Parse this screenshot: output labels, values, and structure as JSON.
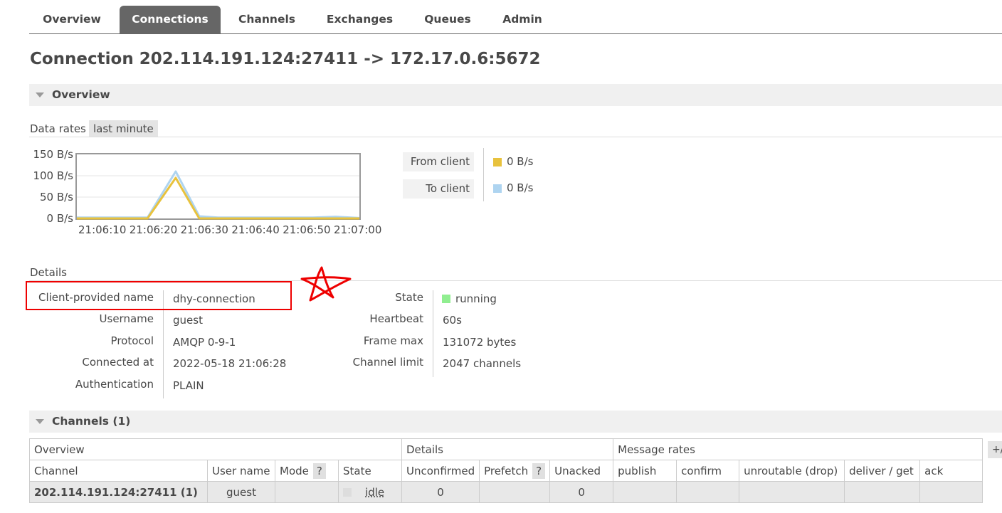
{
  "nav": {
    "tabs": [
      {
        "label": "Overview",
        "active": false
      },
      {
        "label": "Connections",
        "active": true
      },
      {
        "label": "Channels",
        "active": false
      },
      {
        "label": "Exchanges",
        "active": false
      },
      {
        "label": "Queues",
        "active": false
      },
      {
        "label": "Admin",
        "active": false
      }
    ]
  },
  "page_title": "Connection 202.114.191.124:27411 -> 172.17.0.6:5672",
  "overview_section": {
    "label": "Overview",
    "data_rates_label": "Data rates",
    "range_pill": "last minute"
  },
  "chart_data": {
    "type": "line",
    "y_ticks": [
      "150 B/s",
      "100 B/s",
      "50 B/s",
      "0 B/s"
    ],
    "x_ticks": [
      "21:06:10",
      "21:06:20",
      "21:06:30",
      "21:06:40",
      "21:06:50",
      "21:07:00"
    ],
    "ylim": [
      0,
      150
    ],
    "series": [
      {
        "name": "From client",
        "color": "#e8c23d",
        "points": [
          [
            0,
            0
          ],
          [
            15,
            0
          ],
          [
            21,
            95
          ],
          [
            26,
            0
          ],
          [
            60,
            0
          ]
        ]
      },
      {
        "name": "To client",
        "color": "#aed4f0",
        "points": [
          [
            0,
            2
          ],
          [
            15,
            2
          ],
          [
            21,
            110
          ],
          [
            26,
            5
          ],
          [
            30,
            2
          ],
          [
            50,
            2
          ],
          [
            55,
            4
          ],
          [
            60,
            1
          ]
        ]
      }
    ],
    "legend": [
      {
        "label": "From client",
        "value": "0 B/s",
        "color": "#e8c23d"
      },
      {
        "label": "To client",
        "value": "0 B/s",
        "color": "#aed4f0"
      }
    ]
  },
  "details": {
    "label": "Details",
    "left": [
      {
        "key": "Client-provided name",
        "value": "dhy-connection"
      },
      {
        "key": "Username",
        "value": "guest"
      },
      {
        "key": "Protocol",
        "value": "AMQP 0-9-1"
      },
      {
        "key": "Connected at",
        "value": "2022-05-18 21:06:28"
      },
      {
        "key": "Authentication",
        "value": "PLAIN"
      }
    ],
    "right": [
      {
        "key": "State",
        "value": "running"
      },
      {
        "key": "Heartbeat",
        "value": "60s"
      },
      {
        "key": "Frame max",
        "value": "131072 bytes"
      },
      {
        "key": "Channel limit",
        "value": "2047 channels"
      }
    ],
    "state_color": "#90ee90"
  },
  "channels_section": {
    "label": "Channels (1)",
    "group_headers": [
      "Overview",
      "Details",
      "Message rates"
    ],
    "columns": [
      "Channel",
      "User name",
      "Mode",
      "State",
      "Unconfirmed",
      "Prefetch",
      "Unacked",
      "publish",
      "confirm",
      "unroutable (drop)",
      "deliver / get",
      "ack"
    ],
    "help_mark": "?",
    "plus_minus": "+/-",
    "rows": [
      {
        "channel": "202.114.191.124:27411 (1)",
        "user": "guest",
        "mode": "",
        "state": "idle",
        "unconfirmed": "0",
        "prefetch": "",
        "unacked": "0",
        "publish": "",
        "confirm": "",
        "unroutable": "",
        "deliver_get": "",
        "ack": ""
      }
    ]
  },
  "colors": {
    "annotation_red": "#e00000",
    "nav_active": "#666666"
  }
}
